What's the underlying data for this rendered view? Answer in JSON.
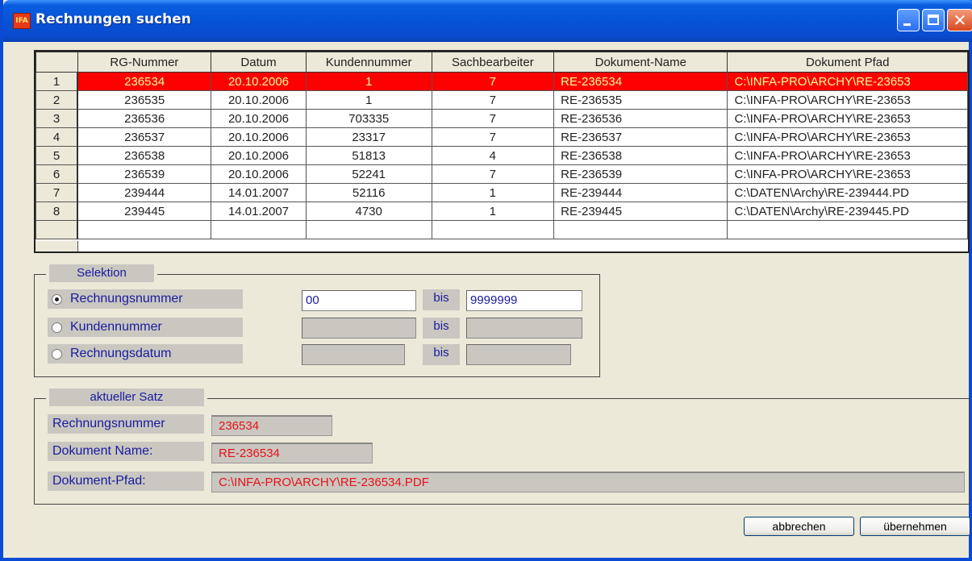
{
  "window": {
    "title": "Rechnungen suchen",
    "icon": "infa-app-icon"
  },
  "grid": {
    "columns": [
      "",
      "RG-Nummer",
      "Datum",
      "Kundennummer",
      "Sachbearbeiter",
      "Dokument-Name",
      "Dokument Pfad"
    ],
    "rows": [
      [
        "1",
        "236534",
        "20.10.2006",
        "1",
        "7",
        "RE-236534",
        "C:\\INFA-PRO\\ARCHY\\RE-23653"
      ],
      [
        "2",
        "236535",
        "20.10.2006",
        "1",
        "7",
        "RE-236535",
        "C:\\INFA-PRO\\ARCHY\\RE-23653"
      ],
      [
        "3",
        "236536",
        "20.10.2006",
        "703335",
        "7",
        "RE-236536",
        "C:\\INFA-PRO\\ARCHY\\RE-23653"
      ],
      [
        "4",
        "236537",
        "20.10.2006",
        "23317",
        "7",
        "RE-236537",
        "C:\\INFA-PRO\\ARCHY\\RE-23653"
      ],
      [
        "5",
        "236538",
        "20.10.2006",
        "51813",
        "4",
        "RE-236538",
        "C:\\INFA-PRO\\ARCHY\\RE-23653"
      ],
      [
        "6",
        "236539",
        "20.10.2006",
        "52241",
        "7",
        "RE-236539",
        "C:\\INFA-PRO\\ARCHY\\RE-23653"
      ],
      [
        "7",
        "239444",
        "14.01.2007",
        "52116",
        "1",
        "RE-239444",
        "C:\\DATEN\\Archy\\RE-239444.PD"
      ],
      [
        "8",
        "239445",
        "14.01.2007",
        "4730",
        "1",
        "RE-239445",
        "C:\\DATEN\\Archy\\RE-239445.PD"
      ]
    ],
    "selected_row": 0,
    "selection_color": "#ff0000"
  },
  "selektion": {
    "title": "Selektion",
    "bis": "bis",
    "options": [
      {
        "label": "Rechnungsnummer",
        "checked": true,
        "from": "00",
        "to": "9999999"
      },
      {
        "label": "Kundennummer",
        "checked": false,
        "from": "",
        "to": ""
      },
      {
        "label": "Rechnungsdatum",
        "checked": false,
        "from": "",
        "to": ""
      }
    ]
  },
  "aktueller_satz": {
    "title": "aktueller Satz",
    "rechnungsnummer_label": "Rechnungsnummer",
    "rechnungsnummer_value": "236534",
    "dokument_name_label": "Dokument Name:",
    "dokument_name_value": "RE-236534",
    "dokument_pfad_label": "Dokument-Pfad:",
    "dokument_pfad_value": "C:\\INFA-PRO\\ARCHY\\RE-236534.PDF"
  },
  "buttons": {
    "cancel": "abbrechen",
    "ok": "übernehmen"
  }
}
